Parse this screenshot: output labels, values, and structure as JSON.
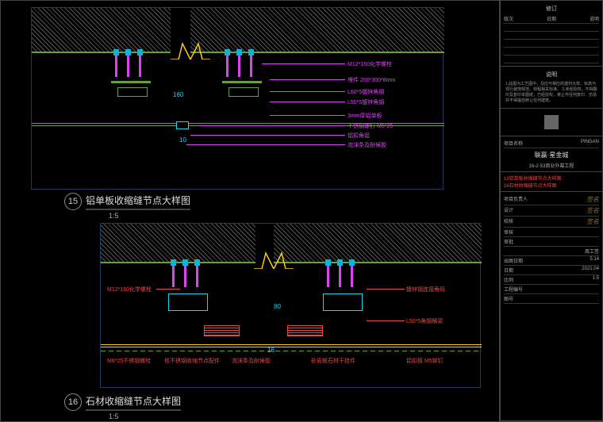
{
  "detail_15": {
    "number": "15",
    "title": "铝单板收缩缝节点大样图",
    "scale": "1:5",
    "dim_h": "160",
    "dim_v": "10",
    "labels": [
      "M12*160化学螺栓",
      "埋件 200*300*8mm",
      "L60*5镀锌角钢",
      "L50*5镀锌角钢",
      "3mm厚铝单板",
      "不锈钢螺钉 M5*25",
      "铝扣角铝",
      "泡沫条及耐候胶"
    ]
  },
  "detail_16": {
    "number": "16",
    "title": "石材收缩缝节点大样图",
    "scale": "1:5",
    "dim_h": "80",
    "dim_v": "16",
    "labels_left": [
      "M12*160化学螺栓",
      "M8*25不锈钢螺栓",
      "毯不锈钢收缩节点配件",
      "泡沫条及耐候胶"
    ],
    "labels_right": [
      "镀锌钢连接角码",
      "L50*5角钢横梁",
      "铝扣板 M5铆钉",
      "砂岩板石材干挂件"
    ]
  },
  "sidebar": {
    "rev_header": "修订",
    "rev_cols": [
      "版次",
      "日期",
      "说明"
    ],
    "note_title": "说明",
    "notes": "1.此图为工艺图中，及应与相应的建材大样、标高与现行装饰规范、规程相关标准。\n2.未经授权，不得翻印及复印本图纸；已经授权，禁止作任何复印、仿造并不得擅自转让任何建筑。",
    "project_label": "项目名称",
    "project_name": "PINGAN",
    "project_title": "联赢·星金城",
    "project_sub": "16-2-53商业外幕工程",
    "drawing_titles": [
      "15铝单板收缩缝节点大样图",
      "16石材收缩缝节点大样图"
    ],
    "rows": [
      {
        "l": "项目负责人",
        "r": ""
      },
      {
        "l": "设计",
        "r": ""
      },
      {
        "l": "校核",
        "r": ""
      },
      {
        "l": "审核",
        "r": ""
      },
      {
        "l": "审批",
        "r": ""
      },
      {
        "l": "",
        "r": "周工签"
      },
      {
        "l": "出图日期",
        "r": "5.14"
      },
      {
        "l": "日期",
        "r": "2021.04"
      },
      {
        "l": "比例",
        "r": "1:5"
      },
      {
        "l": "工程编号",
        "r": ""
      },
      {
        "l": "图号",
        "r": ""
      }
    ]
  }
}
